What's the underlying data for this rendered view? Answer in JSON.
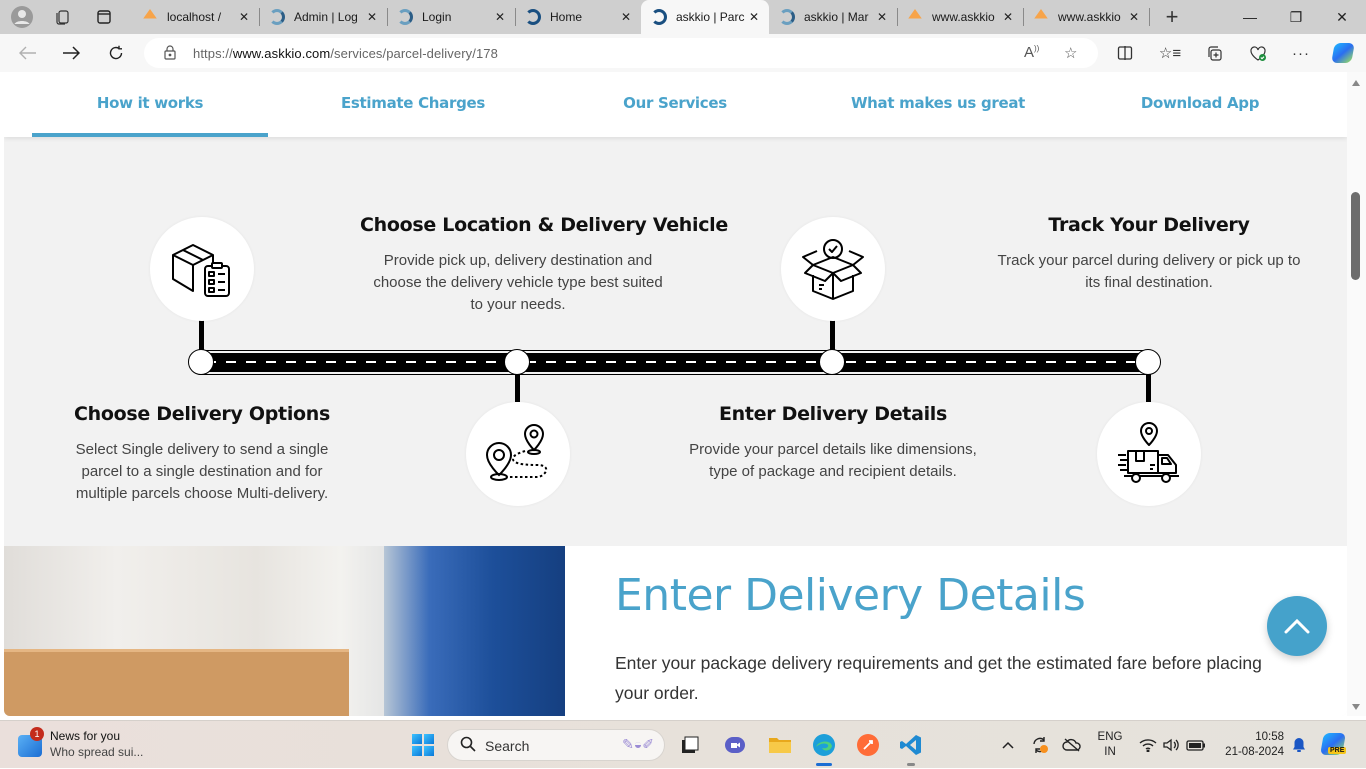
{
  "browser": {
    "tabs": [
      {
        "label": "localhost / ",
        "favicon": "pma-icon",
        "active": false
      },
      {
        "label": "Admin | Log",
        "favicon": "askkio-icon",
        "active": false
      },
      {
        "label": "Login",
        "favicon": "askkio-icon",
        "active": false
      },
      {
        "label": "Home",
        "favicon": "askkio-dark-icon",
        "active": false
      },
      {
        "label": "askkio | Parc",
        "favicon": "askkio-dark-icon",
        "active": true
      },
      {
        "label": "askkio | Mar",
        "favicon": "askkio-icon",
        "active": false
      },
      {
        "label": "www.askkio",
        "favicon": "pma-icon",
        "active": false
      },
      {
        "label": "www.askkio",
        "favicon": "pma-icon",
        "active": false
      }
    ],
    "close_glyph": "✕",
    "new_tab_glyph": "+",
    "url_prefix": "https://",
    "url_host": "www.askkio.com",
    "url_path": "/services/parcel-delivery/178",
    "window_controls": {
      "minimize": "—",
      "restore": "❐",
      "close": "✕"
    }
  },
  "page": {
    "section_tabs": [
      {
        "label": "How it works",
        "active": true
      },
      {
        "label": "Estimate Charges",
        "active": false
      },
      {
        "label": "Our Services",
        "active": false
      },
      {
        "label": "What makes us great",
        "active": false
      },
      {
        "label": "Download App",
        "active": false
      }
    ],
    "steps": [
      {
        "title": "Choose Delivery Options",
        "description": "Select Single delivery to send a single parcel to a single destination and for multiple parcels choose Multi-delivery.",
        "icon": "box-checklist-icon"
      },
      {
        "title": "Choose Location & Delivery Vehicle",
        "description": "Provide pick up, delivery destination and choose the delivery vehicle type best suited to your needs.",
        "icon": "route-pins-icon"
      },
      {
        "title": "Enter Delivery Details",
        "description": "Provide your parcel details like dimensions, type of package and recipient details.",
        "icon": "open-box-check-icon"
      },
      {
        "title": "Track Your Delivery",
        "description": "Track your parcel during delivery or pick up to its final destination.",
        "icon": "delivery-truck-pin-icon"
      }
    ],
    "banner": {
      "title": "Enter Delivery Details",
      "description": "Enter your package delivery requirements and get the estimated fare before placing your order."
    },
    "accent_color": "#4aa3cb"
  },
  "taskbar": {
    "news_title": "News for you",
    "news_subtitle": "Who spread sui...",
    "news_badge": "1",
    "search_label": "Search",
    "language_line1": "ENG",
    "language_line2": "IN",
    "time": "10:58",
    "date": "21-08-2024",
    "copilot_badge": "PRE"
  }
}
